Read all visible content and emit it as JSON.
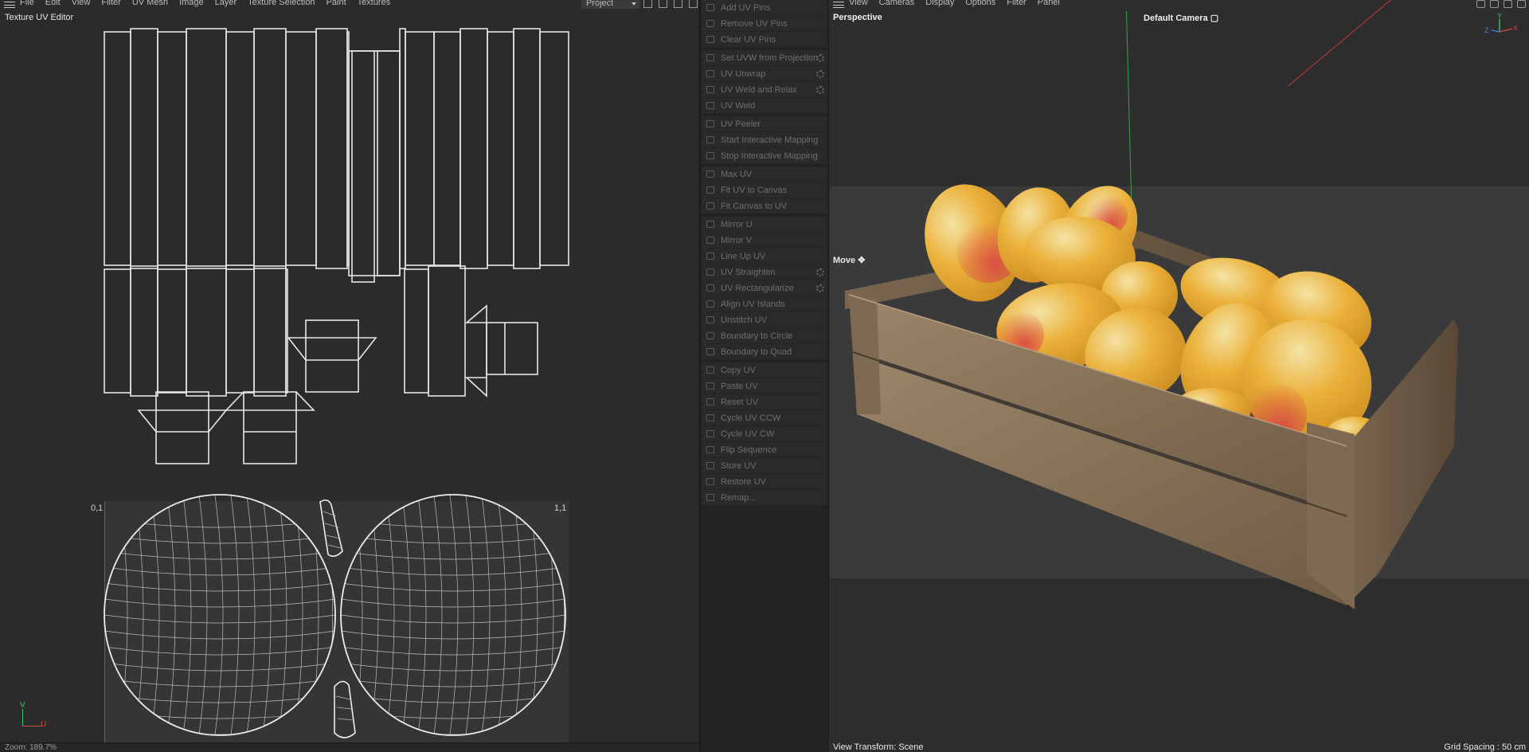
{
  "uv_editor": {
    "menu": [
      "File",
      "Edit",
      "View",
      "Filter",
      "UV Mesh",
      "Image",
      "Layer",
      "Texture Selection",
      "Paint",
      "Textures"
    ],
    "project_select": "Project",
    "title": "Texture UV Editor",
    "label_01": "0,1",
    "label_11": "1,1",
    "axis_v": "V",
    "axis_u": "U",
    "zoom": "Zoom: 189.7%",
    "colors": {
      "wire": "#e6e6e6",
      "v_axis": "#3cc36a",
      "u_axis": "#d34a4a"
    }
  },
  "palette": {
    "groups": [
      [
        {
          "label": "Add UV Pins",
          "icon": "pin-icon"
        },
        {
          "label": "Remove UV Pins",
          "icon": "pin-remove-icon"
        },
        {
          "label": "Clear UV Pins",
          "icon": "clear-icon"
        }
      ],
      [
        {
          "label": "Set UVW from Projection",
          "icon": "projection-icon",
          "gear": true
        },
        {
          "label": "UV Unwrap",
          "icon": "unwrap-icon",
          "gear": true
        },
        {
          "label": "UV Weld and Relax",
          "icon": "weld-relax-icon",
          "gear": true
        },
        {
          "label": "UV Weld",
          "icon": "weld-icon"
        }
      ],
      [
        {
          "label": "UV Peeler",
          "icon": "peeler-icon"
        },
        {
          "label": "Start Interactive Mapping",
          "icon": "play-icon"
        },
        {
          "label": "Stop Interactive Mapping",
          "icon": "stop-icon"
        }
      ],
      [
        {
          "label": "Max UV",
          "icon": "max-icon"
        },
        {
          "label": "Fit UV to Canvas",
          "icon": "fit-icon"
        },
        {
          "label": "Fit Canvas to UV",
          "icon": "fit-canvas-icon"
        }
      ],
      [
        {
          "label": "Mirror U",
          "icon": "mirror-u-icon"
        },
        {
          "label": "Mirror V",
          "icon": "mirror-v-icon"
        },
        {
          "label": "Line Up UV",
          "icon": "line-up-icon"
        },
        {
          "label": "UV Straighten",
          "icon": "straighten-icon",
          "gear": true
        },
        {
          "label": "UV Rectangularize",
          "icon": "rectangularize-icon",
          "gear": true
        },
        {
          "label": "Align UV Islands",
          "icon": "align-icon"
        },
        {
          "label": "Unstitch UV",
          "icon": "unstitch-icon"
        },
        {
          "label": "Boundary to Circle",
          "icon": "circle-icon"
        },
        {
          "label": "Boundary to Quad",
          "icon": "quad-icon"
        }
      ],
      [
        {
          "label": "Copy UV",
          "icon": "copy-icon"
        },
        {
          "label": "Paste UV",
          "icon": "paste-icon"
        },
        {
          "label": "Reset UV",
          "icon": "reset-icon"
        },
        {
          "label": "Cycle UV CCW",
          "icon": "ccw-icon"
        },
        {
          "label": "Cycle UV CW",
          "icon": "cw-icon"
        },
        {
          "label": "Flip Sequence",
          "icon": "flip-icon"
        },
        {
          "label": "Store UV",
          "icon": "store-icon"
        },
        {
          "label": "Restore UV",
          "icon": "restore-icon"
        },
        {
          "label": "Remap...",
          "icon": "remap-icon"
        }
      ]
    ]
  },
  "viewport": {
    "menu": [
      "View",
      "Cameras",
      "Display",
      "Options",
      "Filter",
      "Panel"
    ],
    "perspective": "Perspective",
    "camera": "Default Camera",
    "move": "Move",
    "view_transform": "View Transform: Scene",
    "grid_spacing": "Grid Spacing : 50 cm",
    "gizmo": {
      "y": "Y",
      "x": "X",
      "z": "Z"
    },
    "colors": {
      "mango": "#e9a62e",
      "wood": "#8a7458"
    }
  }
}
